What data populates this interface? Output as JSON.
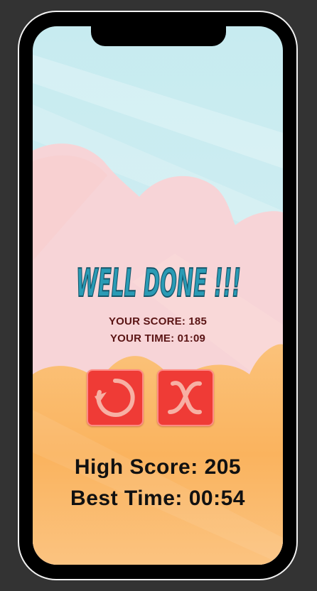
{
  "game": {
    "title": "WELL DONE !!!",
    "your_score_label": "YOUR SCORE: 185",
    "your_time_label": "YOUR TIME: 01:09",
    "high_score_label": "High Score: 205",
    "best_time_label": "Best Time: 00:54"
  },
  "buttons": {
    "restart_icon": "restart-icon",
    "close_icon": "close-x-icon"
  },
  "colors": {
    "sky": "#cdecf0",
    "pink_hills": "#f7d3d6",
    "orange_ground": "#f9b968",
    "button_red": "#ef3b36",
    "title_teal": "#2a9bb5"
  }
}
